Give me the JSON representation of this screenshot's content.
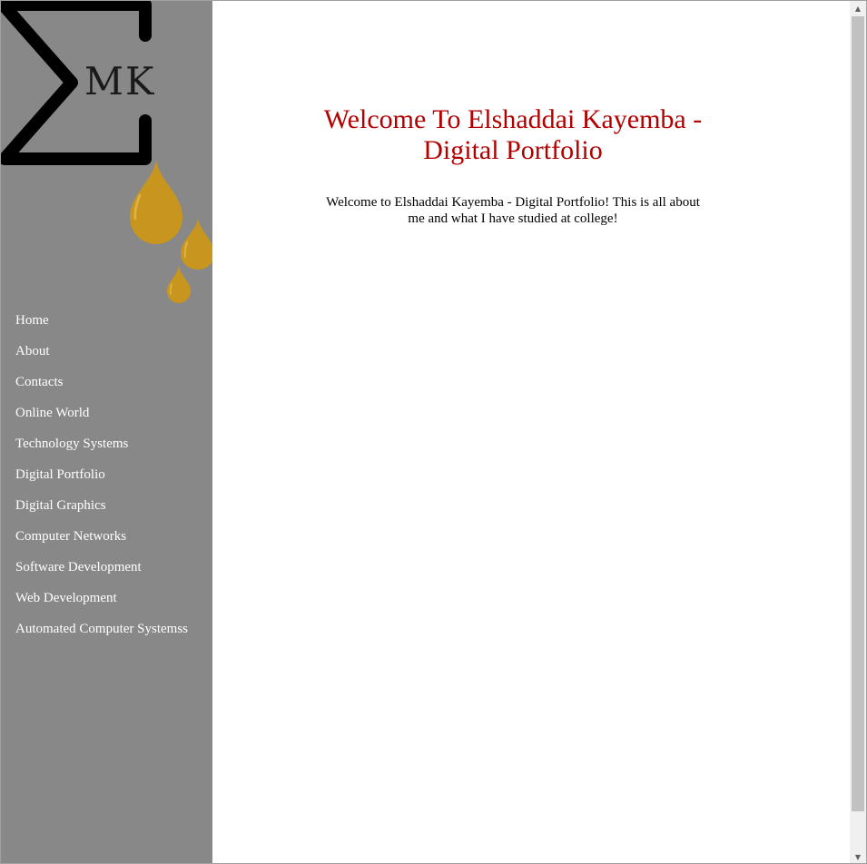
{
  "logo": {
    "text": "MK",
    "colors": {
      "sigma": "#000000",
      "drops": "#c8961e"
    }
  },
  "nav": {
    "items": [
      {
        "label": "Home"
      },
      {
        "label": "About"
      },
      {
        "label": "Contacts"
      },
      {
        "label": "Online World"
      },
      {
        "label": "Technology Systems"
      },
      {
        "label": "Digital Portfolio"
      },
      {
        "label": "Digital Graphics"
      },
      {
        "label": "Computer Networks"
      },
      {
        "label": "Software Development"
      },
      {
        "label": "Web Development"
      },
      {
        "label": "Automated Computer Systemss"
      }
    ]
  },
  "main": {
    "title": "Welcome To Elshaddai Kayemba - Digital Portfolio",
    "intro": "Welcome to Elshaddai Kayemba - Digital Portfolio! This is all about me and what I have studied at college!"
  },
  "scrollbar": {
    "up_icon": "▲",
    "down_icon": "▼"
  },
  "colors": {
    "sidebar_bg": "#888888",
    "title": "#b20000",
    "nav_text": "#ffffff"
  }
}
